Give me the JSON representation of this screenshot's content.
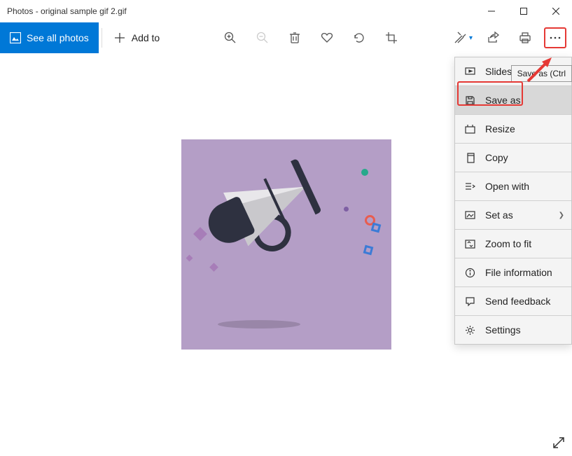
{
  "window": {
    "title": "Photos - original sample gif 2.gif"
  },
  "toolbar": {
    "see_all_label": "See all photos",
    "add_to_label": "Add to"
  },
  "tooltip": {
    "save_as_hint": "Save as (Ctrl"
  },
  "menu": {
    "slideshow": "Slideshow",
    "save_as": "Save as",
    "resize": "Resize",
    "copy": "Copy",
    "open_with": "Open with",
    "set_as": "Set as",
    "zoom_to_fit": "Zoom to fit",
    "file_information": "File information",
    "send_feedback": "Send feedback",
    "settings": "Settings"
  }
}
